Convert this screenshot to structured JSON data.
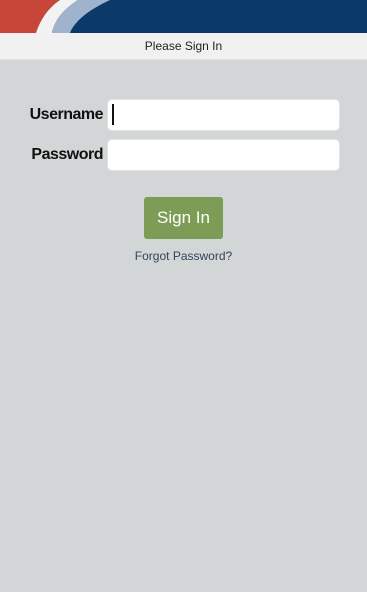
{
  "header": {
    "title": "Please Sign In"
  },
  "form": {
    "username_label": "Username",
    "username_value": "",
    "password_label": "Password",
    "password_value": ""
  },
  "actions": {
    "signin_label": "Sign In",
    "forgot_label": "Forgot Password?"
  },
  "colors": {
    "banner": "#0b3a6a",
    "accent_red": "#c0392b",
    "button": "#7d9d57",
    "background": "#d3d6d7"
  }
}
